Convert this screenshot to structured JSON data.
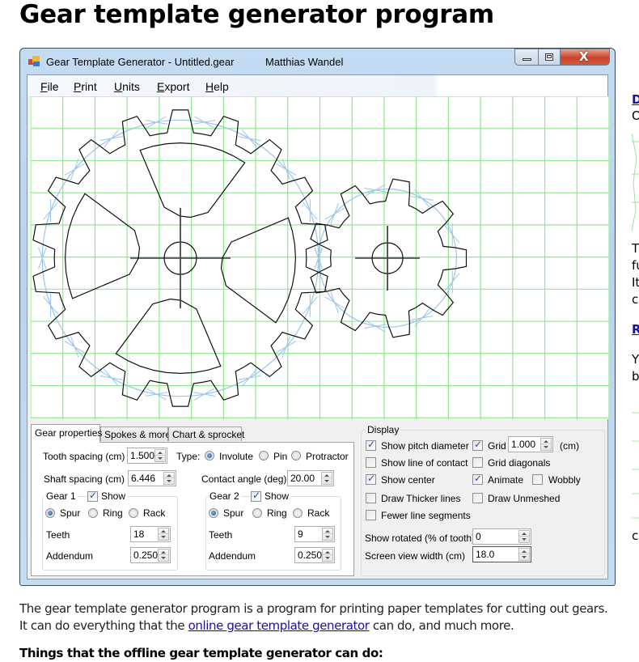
{
  "page": {
    "title": "Gear template generator program",
    "intro_line1": "The gear template generator program is a program for printing paper templates for cutting out gears.",
    "intro_line2_before": "It can do everything that the ",
    "intro_link": "online gear template generator",
    "intro_line2_after": " can do, and much more.",
    "things_heading": "Things that the offline gear template generator can do:",
    "side_fragments": [
      "D",
      "O",
      "T",
      "fu",
      "It",
      "ca",
      "R",
      "Y",
      "b",
      "c"
    ]
  },
  "window": {
    "title": "Gear Template Generator - Untitled.gear",
    "author": "Matthias Wandel",
    "controls": {
      "minimize": "minimize",
      "maximize": "maximize",
      "close": "X"
    },
    "menu": [
      {
        "key": "F",
        "rest": "ile"
      },
      {
        "key": "P",
        "rest": "rint"
      },
      {
        "key": "U",
        "rest": "nits"
      },
      {
        "key": "E",
        "rest": "xport"
      },
      {
        "key": "H",
        "rest": "elp"
      }
    ]
  },
  "tabs": [
    {
      "label": "Gear properties",
      "active": true
    },
    {
      "label": "Spokes & more",
      "active": false
    },
    {
      "label": "Chart & sprocket",
      "active": false
    }
  ],
  "gear_properties": {
    "tooth_spacing_label": "Tooth spacing (cm)",
    "tooth_spacing_value": "1.500",
    "type_label": "Type:",
    "type_options": [
      {
        "label": "Involute",
        "selected": true
      },
      {
        "label": "Pin",
        "selected": false
      },
      {
        "label": "Protractor",
        "selected": false
      }
    ],
    "shaft_spacing_label": "Shaft spacing (cm)",
    "shaft_spacing_value": "6.446",
    "contact_angle_label": "Contact angle (deg)",
    "contact_angle_value": "20.00",
    "gear1": {
      "title": "Gear 1",
      "show_label": "Show",
      "show": true,
      "kinds": [
        {
          "label": "Spur",
          "selected": true
        },
        {
          "label": "Ring",
          "selected": false
        },
        {
          "label": "Rack",
          "selected": false
        }
      ],
      "teeth_label": "Teeth",
      "teeth": "18",
      "addendum_label": "Addendum",
      "addendum": "0.250"
    },
    "gear2": {
      "title": "Gear 2",
      "show_label": "Show",
      "show": true,
      "kinds": [
        {
          "label": "Spur",
          "selected": true
        },
        {
          "label": "Ring",
          "selected": false
        },
        {
          "label": "Rack",
          "selected": false
        }
      ],
      "teeth_label": "Teeth",
      "teeth": "9",
      "addendum_label": "Addendum",
      "addendum": "0.250"
    }
  },
  "display": {
    "title": "Display",
    "options": [
      {
        "label": "Show pitch diameter",
        "checked": true
      },
      {
        "label": "Show line of contact",
        "checked": false
      },
      {
        "label": "Show center",
        "checked": true
      },
      {
        "label": "Draw Thicker lines",
        "checked": false
      },
      {
        "label": "Fewer line segments",
        "checked": false
      },
      {
        "label": "Grid",
        "checked": true
      },
      {
        "label": "Grid diagonals",
        "checked": false
      },
      {
        "label": "Animate",
        "checked": true
      },
      {
        "label": "Wobbly",
        "checked": false
      },
      {
        "label": "Draw Unmeshed",
        "checked": false
      }
    ],
    "grid_value": "1.000",
    "grid_unit": "(cm)",
    "show_rotated_label": "Show rotated (% of tooth)",
    "show_rotated_value": "0",
    "screen_width_label": "Screen view width (cm)",
    "screen_width_value": "18.0"
  },
  "colors": {
    "grid": "#90e890",
    "pitch_circle": "#9cc4ea",
    "gear_outline": "#111111",
    "close_button": "#c7442a",
    "link": "#1a0dab"
  },
  "drawing": {
    "gear1_teeth": 18,
    "gear2_teeth": 9,
    "tooth_spacing_cm": 1.5,
    "shaft_spacing_cm": 6.446,
    "grid_spacing_cm": 1.0,
    "view_width_cm": 18.0,
    "gear1_spokes": 4
  }
}
